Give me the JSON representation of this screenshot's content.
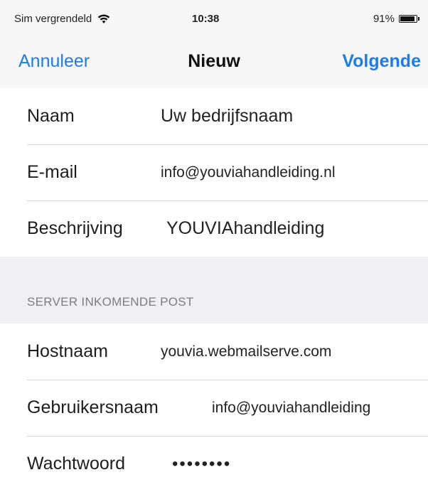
{
  "status": {
    "carrier": "Sim vergrendeld",
    "time": "10:38",
    "battery_text": "91%",
    "battery_level": 0.91
  },
  "nav": {
    "cancel": "Annuleer",
    "title": "Nieuw",
    "next": "Volgende"
  },
  "account": {
    "name_label": "Naam",
    "name_value": "Uw bedrijfsnaam",
    "email_label": "E-mail",
    "email_value": "info@youviahandleiding.nl",
    "description_label": "Beschrijving",
    "description_value": "YOUVIAhandleiding"
  },
  "incoming": {
    "section_title": "SERVER INKOMENDE POST",
    "host_label": "Hostnaam",
    "host_value": "youvia.webmailserve.com",
    "user_label": "Gebruikersnaam",
    "user_value": "info@youviahandleiding",
    "password_label": "Wachtwoord",
    "password_value": "••••••••"
  }
}
